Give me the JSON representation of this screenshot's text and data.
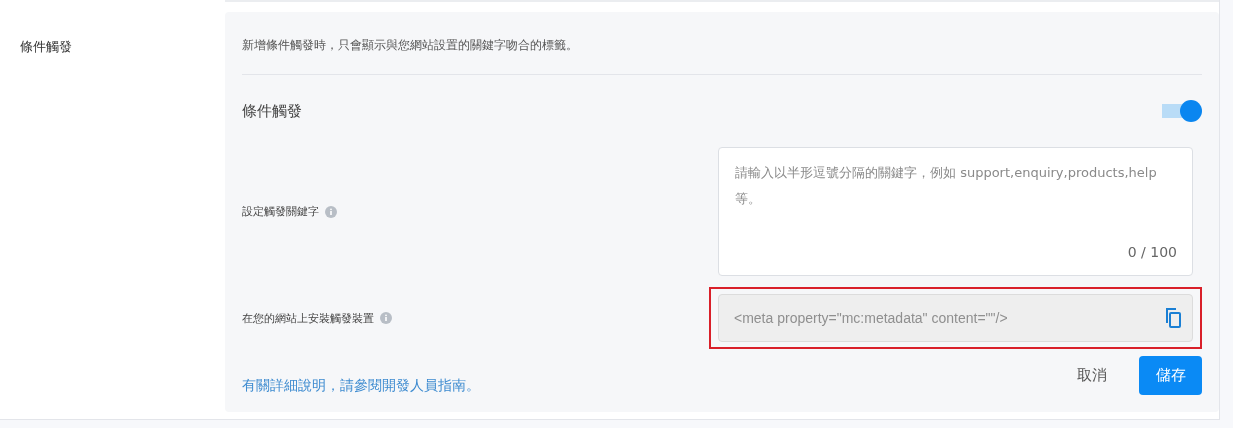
{
  "section_label": "條件觸發",
  "description": "新增條件觸發時，只會顯示與您網站設置的關鍵字吻合的標籤。",
  "trigger_toggle": {
    "label": "條件觸發",
    "on": true
  },
  "keywords_field": {
    "label": "設定觸發關鍵字",
    "placeholder": "請輸入以半形逗號分隔的關鍵字，例如 support,enquiry,products,help 等。",
    "counter": "0 / 100"
  },
  "install_field": {
    "label": "在您的網站上安裝觸發裝置",
    "value": "<meta property=\"mc:metadata\" content=\"\"/>",
    "highlighted": true
  },
  "guide_link": "有關詳細說明，請參閱開發人員指南。",
  "buttons": [
    {
      "label": "取消",
      "kind": "text"
    },
    {
      "label": "儲存",
      "kind": "primary"
    }
  ]
}
